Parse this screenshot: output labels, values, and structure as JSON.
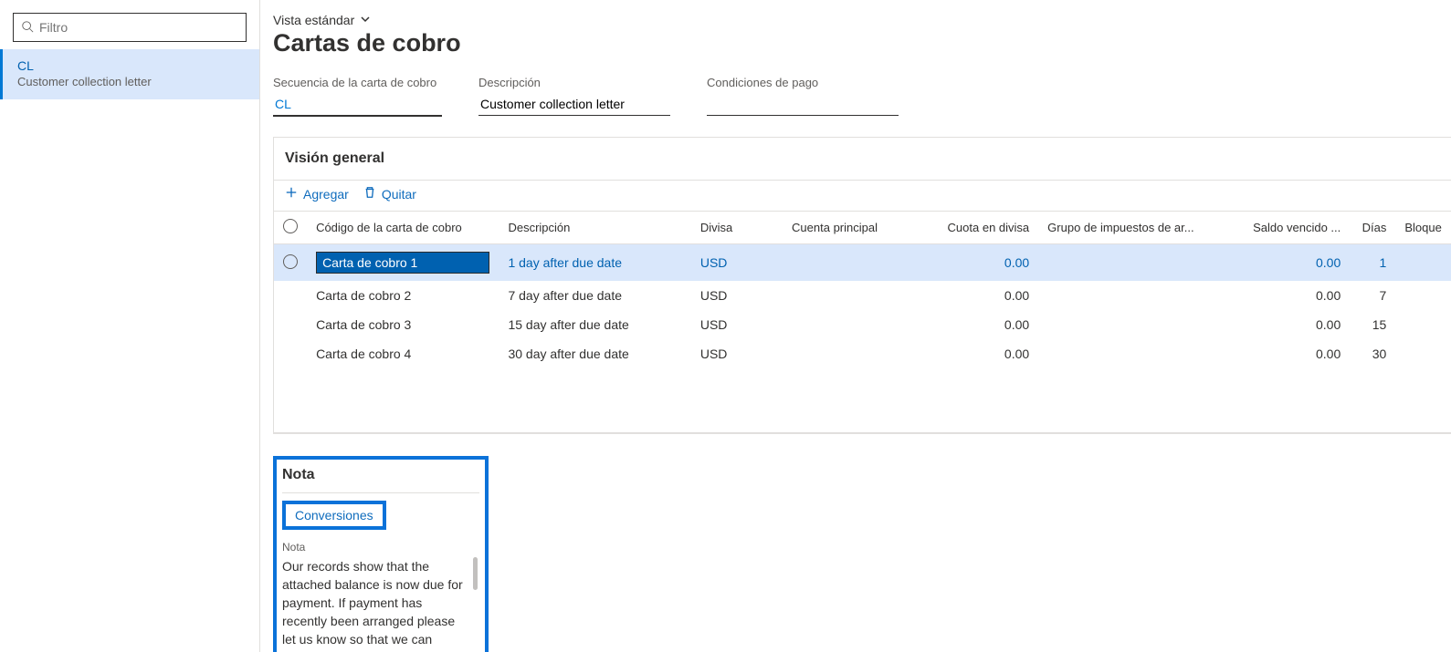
{
  "filter": {
    "placeholder": "Filtro"
  },
  "sidebar": {
    "items": [
      {
        "code": "CL",
        "desc": "Customer collection letter"
      }
    ]
  },
  "header": {
    "view_label": "Vista estándar",
    "page_title": "Cartas de cobro",
    "fields": {
      "sequence_label": "Secuencia de la carta de cobro",
      "sequence_value": "CL",
      "description_label": "Descripción",
      "description_value": "Customer collection letter",
      "payterms_label": "Condiciones de pago",
      "payterms_value": ""
    }
  },
  "panel": {
    "title": "Visión general",
    "add_label": "Agregar",
    "remove_label": "Quitar",
    "columns": {
      "code": "Código de la carta de cobro",
      "desc": "Descripción",
      "currency": "Divisa",
      "account": "Cuenta principal",
      "fee": "Cuota en divisa",
      "tax": "Grupo de impuestos de ar...",
      "balance": "Saldo vencido ...",
      "days": "Días",
      "block": "Bloque"
    },
    "rows": [
      {
        "code": "Carta de cobro 1",
        "desc": "1 day after due date",
        "currency": "USD",
        "account": "",
        "fee": "0.00",
        "tax": "",
        "balance": "0.00",
        "days": "1"
      },
      {
        "code": "Carta de cobro 2",
        "desc": "7 day after due date",
        "currency": "USD",
        "account": "",
        "fee": "0.00",
        "tax": "",
        "balance": "0.00",
        "days": "7"
      },
      {
        "code": "Carta de cobro 3",
        "desc": "15 day after due date",
        "currency": "USD",
        "account": "",
        "fee": "0.00",
        "tax": "",
        "balance": "0.00",
        "days": "15"
      },
      {
        "code": "Carta de cobro 4",
        "desc": "30 day after due date",
        "currency": "USD",
        "account": "",
        "fee": "0.00",
        "tax": "",
        "balance": "0.00",
        "days": "30"
      }
    ]
  },
  "note": {
    "section_title": "Nota",
    "conversions_label": "Conversiones",
    "field_label": "Nota",
    "text": "Our records show that the attached balance is now due for payment.  If payment has recently been arranged please let us know so that we can"
  }
}
